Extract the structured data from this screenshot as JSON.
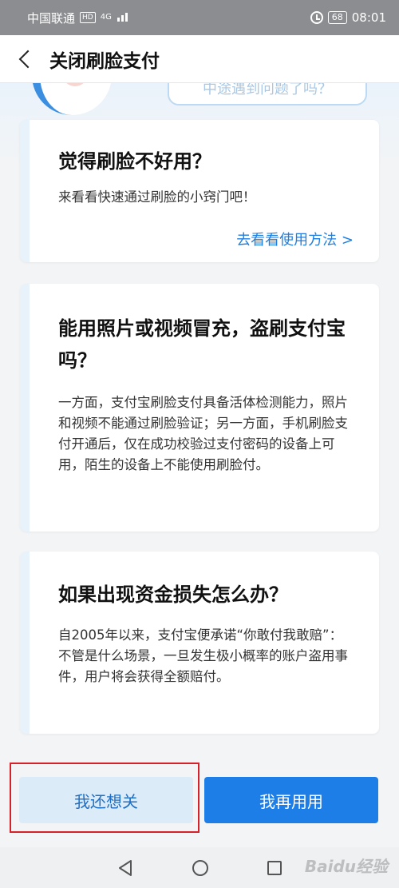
{
  "status_bar": {
    "carrier": "中国联通",
    "hd_badge": "HD",
    "network": "4G",
    "battery": "68",
    "time": "08:01"
  },
  "nav": {
    "title": "关闭刷脸支付"
  },
  "banner": {
    "bubble_text": "中途遇到问题了吗？"
  },
  "cards": [
    {
      "title": "觉得刷脸不好用？",
      "text": "来看看快速通过刷脸的小窍门吧！",
      "link": "去看看使用方法 >"
    },
    {
      "title": "能用照片或视频冒充，盗刷支付宝吗？",
      "text": "一方面，支付宝刷脸支付具备活体检测能力，照片和视频不能通过刷脸验证；另一方面，手机刷脸支付开通后，仅在成功校验过支付密码的设备上可用，陌生的设备上不能使用刷脸付。"
    },
    {
      "title": "如果出现资金损失怎么办？",
      "text": "自2005年以来，支付宝便承诺“你敢付我敢赔”：不管是什么场景，一旦发生极小概率的账户盗用事件，用户将会获得全额赔付。"
    }
  ],
  "buttons": {
    "close_label": "我还想关",
    "keep_label": "我再用用"
  },
  "watermark": "Baidu经验",
  "colors": {
    "accent": "#1e7ee8",
    "secondary_button_bg": "#dcebf8",
    "highlight_border": "#d6202a"
  },
  "icons": [
    "back-icon",
    "alarm-icon",
    "sys-back-icon",
    "sys-home-icon",
    "sys-recent-icon"
  ]
}
